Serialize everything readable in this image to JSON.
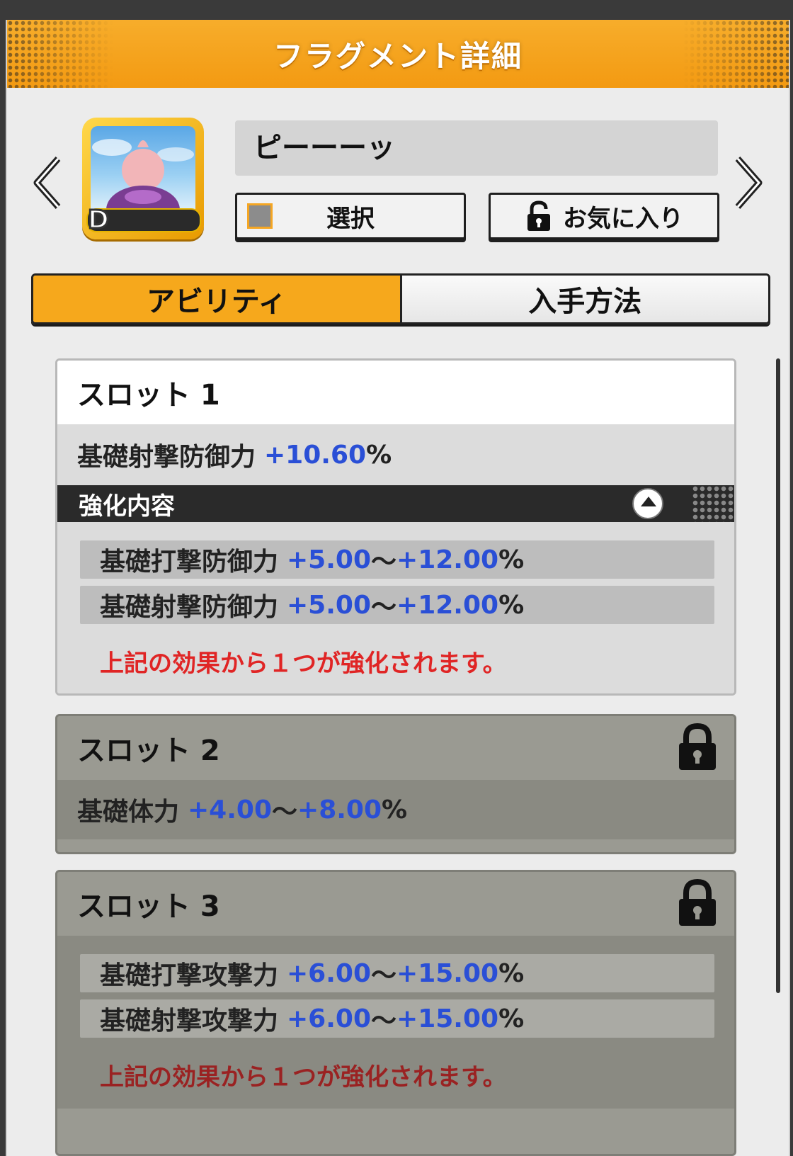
{
  "header": {
    "title": "フラグメント詳細"
  },
  "nav": {
    "prev": "prev",
    "next": "next"
  },
  "fragment": {
    "name": "ピーーーッ",
    "rank": "D"
  },
  "buttons": {
    "select_label": "選択",
    "favorite_label": "お気に入り"
  },
  "tabs": [
    {
      "label": "アビリティ",
      "active": true
    },
    {
      "label": "入手方法",
      "active": false
    }
  ],
  "slots": [
    {
      "title": "スロット 1",
      "locked": false,
      "main_stat": {
        "name": "基礎射撃防御力",
        "value": "+10.60",
        "unit": "%"
      },
      "enhance_label": "強化内容",
      "ranges": [
        {
          "name": "基礎打撃防御力",
          "min": "+5.00",
          "sep": "〜",
          "max": "+12.00",
          "unit": "%"
        },
        {
          "name": "基礎射撃防御力",
          "min": "+5.00",
          "sep": "〜",
          "max": "+12.00",
          "unit": "%"
        }
      ],
      "note": "上記の効果から１つが強化されます。"
    },
    {
      "title": "スロット 2",
      "locked": true,
      "main_stat": {
        "name": "基礎体力",
        "min": "+4.00",
        "sep": "〜",
        "max": "+8.00",
        "unit": "%"
      }
    },
    {
      "title": "スロット 3",
      "locked": true,
      "ranges": [
        {
          "name": "基礎打撃攻撃力",
          "min": "+6.00",
          "sep": "〜",
          "max": "+15.00",
          "unit": "%"
        },
        {
          "name": "基礎射撃攻撃力",
          "min": "+6.00",
          "sep": "〜",
          "max": "+15.00",
          "unit": "%"
        }
      ],
      "note": "上記の効果から１つが強化されます。"
    }
  ],
  "colors": {
    "accent": "#f6a81c",
    "value_blue": "#2a4fd6",
    "note_red": "#e02525"
  }
}
